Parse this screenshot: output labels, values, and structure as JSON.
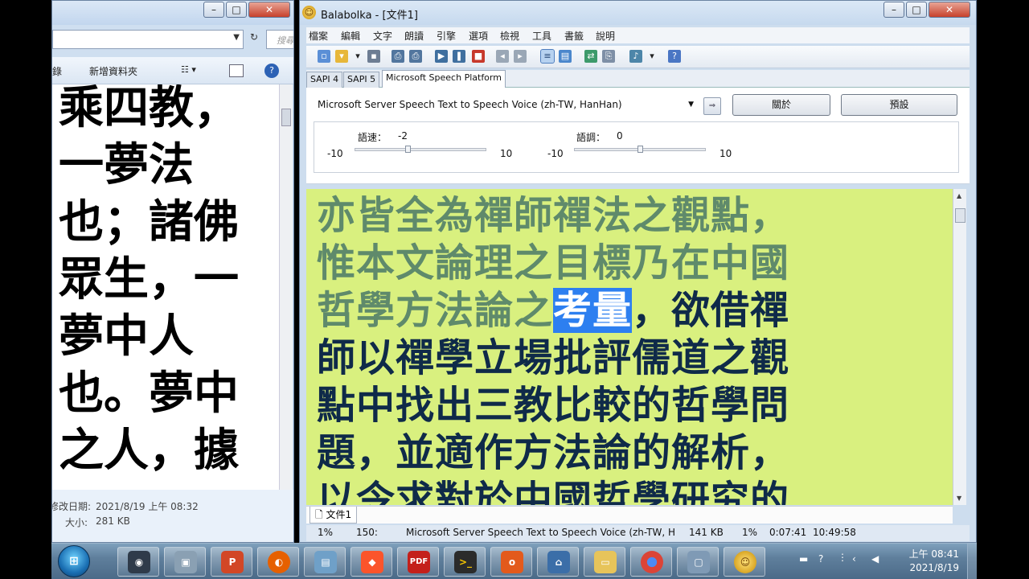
{
  "explorer": {
    "search_placeholder": "搜尋 桌...",
    "toolbar": {
      "item1": "錄",
      "item2": "新增資料夾"
    },
    "content_lines": [
      "乘四教，",
      "一夢法",
      "也；諸佛",
      "眾生，一",
      "夢中人",
      "也。夢中",
      "之人，據"
    ],
    "details": {
      "modified_label": "修改日期:",
      "modified_value": "2021/8/19 上午 08:32",
      "size_label": "大小:",
      "size_value": "281 KB"
    }
  },
  "balabolka": {
    "title": "Balabolka - [文件1]",
    "menu": [
      "檔案",
      "編輯",
      "文字",
      "朗讀",
      "引擎",
      "選項",
      "檢視",
      "工具",
      "書籤",
      "說明"
    ],
    "tabs": [
      "SAPI 4",
      "SAPI 5",
      "Microsoft Speech Platform"
    ],
    "voice": "Microsoft Server Speech Text to Speech Voice (zh-TW, HanHan)",
    "about_button": "關於",
    "default_button": "預設",
    "rate": {
      "label": "語速：",
      "value": "-2",
      "min": "-10",
      "max": "10",
      "level_fraction": 0.4
    },
    "pitch": {
      "label": "語調：",
      "value": "0",
      "min": "-10",
      "max": "10",
      "level_fraction": 0.5
    },
    "text": {
      "line1": "亦皆全為禪師禪法之觀點，",
      "line2": "惟本文論理之目標乃在中國",
      "line3_read": "哲學方法論之",
      "line3_hl": "考量",
      "line3_unread": "，欲借禪",
      "line4": "師以禪學立場批評儒道之觀",
      "line5": "點中找出三教比較的哲學問",
      "line6": "題，並適作方法論的解析，",
      "line7": "以令求對於中國哲學研究的"
    },
    "doc_tab": "文件1",
    "status": {
      "percent_left": "1%",
      "position": "150:",
      "voice": "Microsoft Server Speech Text to Speech Voice (zh-TW, H",
      "size": "141 KB",
      "percent": "1%",
      "elapsed": "0:07:41",
      "time": "10:49:58"
    }
  },
  "taskbar": {
    "items": [
      "Windows Media Center",
      "Photos",
      "PowerPoint",
      "Firefox",
      "Notepad",
      "Brave",
      "PDF",
      "Terminal",
      "Office",
      "Network",
      "Explorer",
      "Chrome",
      "Window",
      "Balabolka"
    ],
    "clock_time": "上午 08:41",
    "clock_date": "2021/8/19"
  },
  "colors": {
    "text_bg": "#d9f07f",
    "read_text": "#5f8a6b",
    "unread_text": "#0f2a49",
    "highlight": "#2d7ff0"
  }
}
